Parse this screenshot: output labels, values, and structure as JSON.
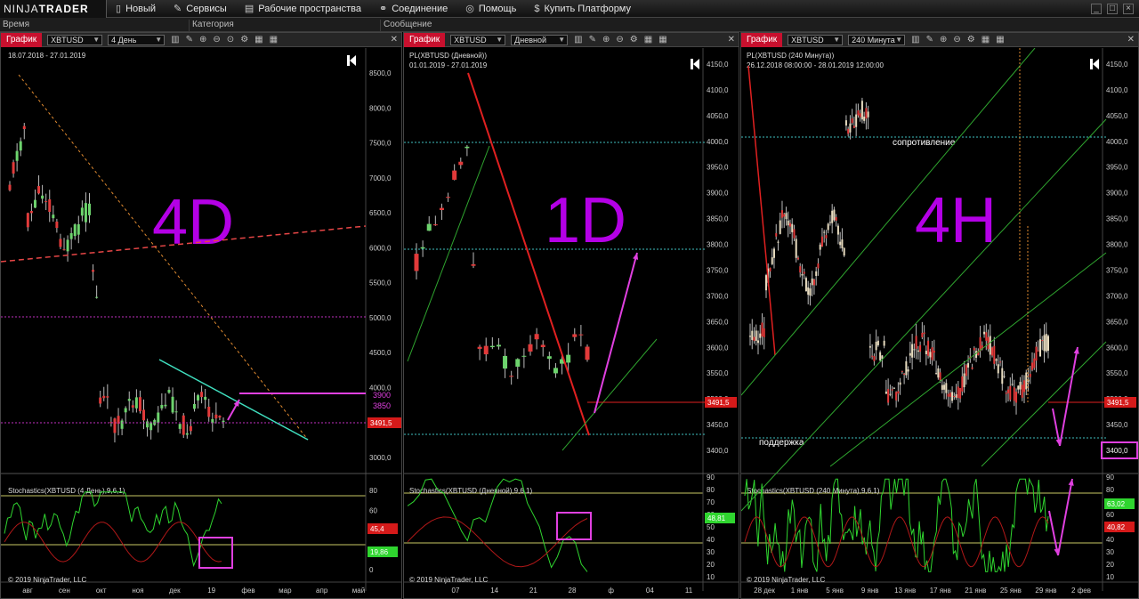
{
  "menubar": {
    "logo_a": "NINJA",
    "logo_b": "TRADER",
    "items": [
      {
        "label": "Новый",
        "icon": "document-icon"
      },
      {
        "label": "Сервисы",
        "icon": "wrench-icon"
      },
      {
        "label": "Рабочие пространства",
        "icon": "workspace-icon"
      },
      {
        "label": "Соединение",
        "icon": "connection-icon"
      },
      {
        "label": "Помощь",
        "icon": "help-icon"
      },
      {
        "label": "Купить Платформу",
        "icon": "dollar-icon"
      }
    ]
  },
  "columns": {
    "time": "Время",
    "category": "Категория",
    "message": "Сообщение"
  },
  "panels": [
    {
      "tab": "График",
      "symbol": "XBTUSD",
      "period": "4 День",
      "range": "18.07.2018 - 27.01.2019",
      "big_label": "4D",
      "price_ticks": [
        "8500,0",
        "8000,0",
        "7500,0",
        "7000,0",
        "6500,0",
        "6000,0",
        "5500,0",
        "5000,0",
        "4500,0",
        "4000,0",
        "3500,0",
        "3000,0"
      ],
      "marks": {
        "a": "3900",
        "b": "3850",
        "last": "3491,5"
      },
      "stoch_title": "Stochastics(XBTUSD (4 День),9,6,1)",
      "stoch_ticks": [
        "80",
        "60",
        "40",
        "20",
        "0"
      ],
      "stoch_vals": {
        "a": "45,4",
        "b": "19,86"
      },
      "x_ticks": [
        "авг",
        "сен",
        "окт",
        "ноя",
        "дек",
        "19",
        "фев",
        "мар",
        "апр",
        "май"
      ],
      "copyright": "© 2019 NinjaTrader, LLC"
    },
    {
      "tab": "График",
      "symbol": "XBTUSD",
      "period": "Дневной",
      "title": "PL(XBTUSD (Дневной))",
      "range": "01.01.2019 - 27.01.2019",
      "big_label": "1D",
      "price_ticks": [
        "4150,0",
        "4100,0",
        "4050,0",
        "4000,0",
        "3950,0",
        "3900,0",
        "3850,0",
        "3800,0",
        "3750,0",
        "3700,0",
        "3650,0",
        "3600,0",
        "3550,0",
        "3500,0",
        "3450,0",
        "3400,0"
      ],
      "marks": {
        "last": "3491,5"
      },
      "stoch_title": "Stochastics(XBTUSD (Дневной),9,6,1)",
      "stoch_ticks": [
        "90",
        "80",
        "70",
        "60",
        "50",
        "40",
        "30",
        "20",
        "10"
      ],
      "stoch_vals": {
        "a": "48,81"
      },
      "x_ticks": [
        "07",
        "14",
        "21",
        "28",
        "ф",
        "04",
        "11"
      ],
      "copyright": "© 2019 NinjaTrader, LLC"
    },
    {
      "tab": "График",
      "symbol": "XBTUSD",
      "period": "240 Минута",
      "title": "PL(XBTUSD (240 Минута))",
      "range": "26.12.2018 08:00:00 - 28.01.2019 12:00:00",
      "big_label": "4H",
      "resistance": "сопротивление",
      "support": "поддержка",
      "price_ticks": [
        "4150,0",
        "4100,0",
        "4050,0",
        "4000,0",
        "3950,0",
        "3900,0",
        "3850,0",
        "3800,0",
        "3750,0",
        "3700,0",
        "3650,0",
        "3600,0",
        "3550,0",
        "3500,0",
        "3450,0",
        "3400,0"
      ],
      "marks": {
        "last": "3491,5",
        "target": "3400,0"
      },
      "stoch_title": "Stochastics(XBTUSD (240 Минута),9,6,1)",
      "stoch_ticks": [
        "90",
        "80",
        "70",
        "60",
        "50",
        "40",
        "30",
        "20",
        "10"
      ],
      "stoch_vals": {
        "a": "63,02",
        "b": "40,82"
      },
      "x_ticks": [
        "28 дек",
        "1 янв",
        "5 янв",
        "9 янв",
        "13 янв",
        "17 янв",
        "21 янв",
        "25 янв",
        "29 янв",
        "2 фев"
      ],
      "copyright": "© 2019 NinjaTrader, LLC"
    }
  ],
  "colors": {
    "up": "#6dd36d",
    "down": "#e23a3a",
    "accent": "#c8102e",
    "magenta": "#d438d4",
    "label": "#b400e6"
  }
}
